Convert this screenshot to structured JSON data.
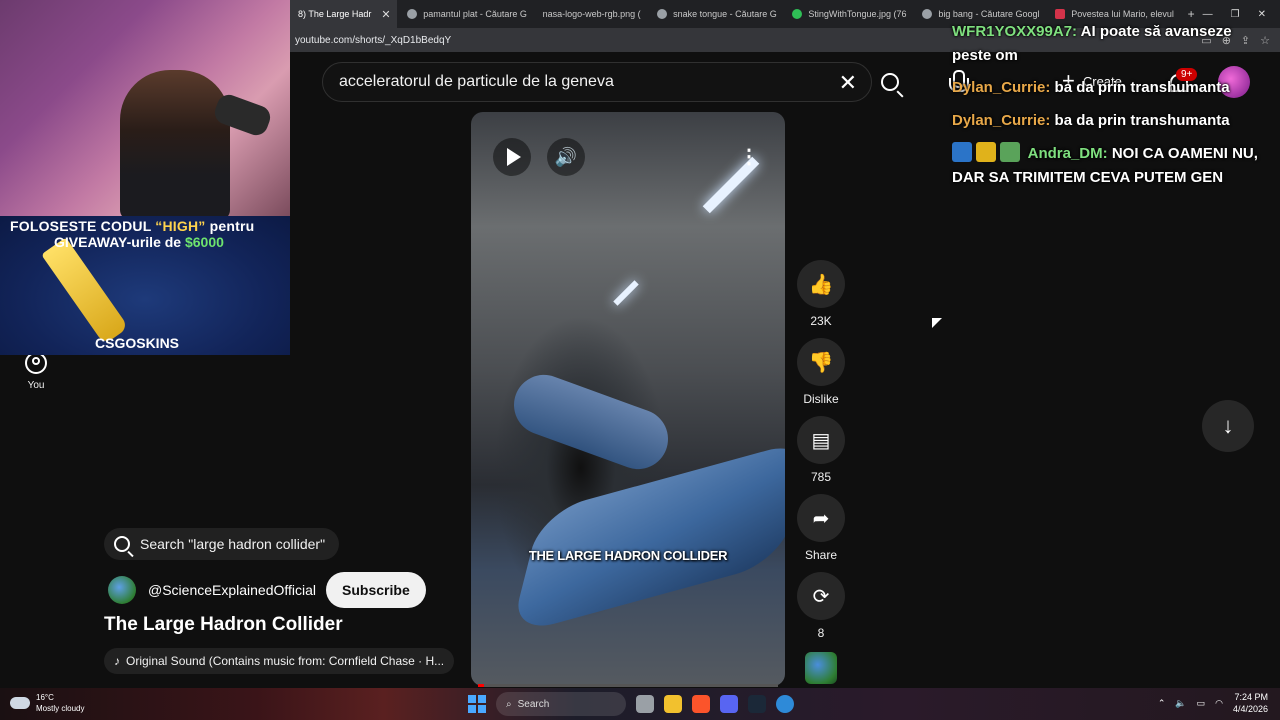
{
  "browser": {
    "tabs": [
      {
        "label": "8) The Large Hadr",
        "active": true
      },
      {
        "label": "pamantul plat - Căutare G"
      },
      {
        "label": "nasa-logo-web-rgb.png ("
      },
      {
        "label": "snake tongue - Căutare G"
      },
      {
        "label": "StingWithTongue.jpg (76"
      },
      {
        "label": "big bang - Căutare Googl"
      },
      {
        "label": "Povestea lui Mario, elevul"
      }
    ],
    "new_tab": "+",
    "url": "youtube.com/shorts/_XqD1bBedqY"
  },
  "stream_overlay": {
    "promo_line1_pre": "FOLOSESTE CODUL ",
    "promo_code": "“HIGH”",
    "promo_line1_post": " pentru",
    "promo_line2_pre": "GIVEAWAY-urile de ",
    "promo_amount": "$6000",
    "brand": "CSGOSKINS"
  },
  "nav": {
    "you_label": "You"
  },
  "search": {
    "query": "acceleratorul de particule de la geneva"
  },
  "header": {
    "create_label": "Create",
    "notifications_badge": "9+"
  },
  "short": {
    "caption": "THE LARGE HADRON COLLIDER",
    "progress_percent": 2
  },
  "actions": {
    "like_count": "23K",
    "dislike_label": "Dislike",
    "comment_count": "785",
    "share_label": "Share",
    "remix_count": "8"
  },
  "info": {
    "search_chip": "Search \"large hadron collider\"",
    "channel": "@ScienceExplainedOfficial",
    "subscribe_label": "Subscribe",
    "title": "The Large Hadron Collider",
    "sound": "Original Sound (Contains music from: Cornfield Chase · H..."
  },
  "chat": [
    {
      "user": "WFR1YOXX99A7:",
      "text": "AI poate să avanseze peste om"
    },
    {
      "user": "Dylan_Currie:",
      "text": "ba da prin transhumanta"
    },
    {
      "user": "Dylan_Currie:",
      "text": "ba da prin transhumanta"
    },
    {
      "user": "Andra_DM:",
      "text": "NOI CA OAMENI NU, DAR SA TRIMITEM CEVA PUTEM GEN"
    }
  ],
  "taskbar": {
    "temp": "16°C",
    "weather": "Mostly cloudy",
    "search_label": "Search",
    "time": "7:24 PM",
    "date": "4/4/2026"
  },
  "icons": {
    "like": "thumbs-up-icon",
    "dislike": "thumbs-down-icon",
    "comment": "comment-icon",
    "share": "share-icon",
    "remix": "remix-icon"
  },
  "colors": {
    "youtube_bg": "#0f0f0f",
    "subscribe_bg": "#f1f1f1",
    "progress": "#ff0000",
    "chat_user_green": "#7fe07f",
    "chat_user_orange": "#e8a849"
  }
}
